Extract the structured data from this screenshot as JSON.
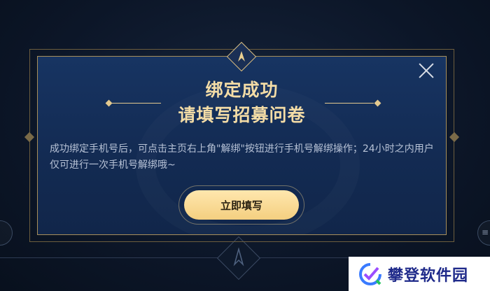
{
  "modal": {
    "title_line1": "绑定成功",
    "title_line2": "请填写招募问卷",
    "body": "成功绑定手机号后，可点击主页右上角\"解绑\"按钮进行手机号解绑操作；24小时之内用户仅可进行一次手机号解绑哦~",
    "cta_label": "立即填写",
    "close_icon": "close-icon",
    "emblem_icon": "crest-icon"
  },
  "background": {
    "right_edge_text": "≡"
  },
  "watermark": {
    "text": "攀登软件园",
    "logo_icon": "check-logo-icon"
  },
  "colors": {
    "accent_gold": "#f3dca6",
    "button_gold": "#f4cf80",
    "modal_blue": "#173462",
    "watermark_blue": "#1f2a8a"
  }
}
